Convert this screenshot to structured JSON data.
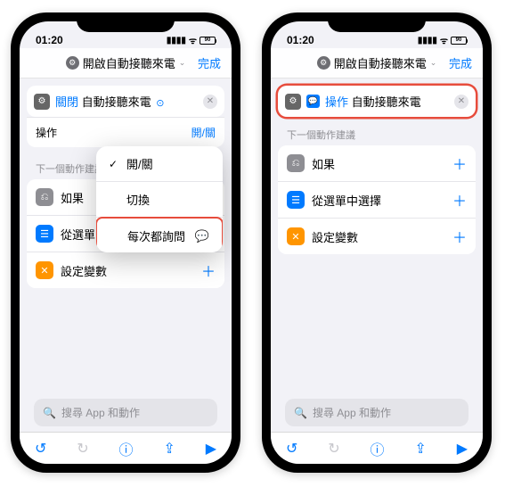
{
  "status": {
    "time": "01:20",
    "battery": "90"
  },
  "nav": {
    "title": "開啟自動接聽來電",
    "done": "完成"
  },
  "left": {
    "action_state": "關閉",
    "action_label": "自動接聽來電",
    "param_label": "操作",
    "param_value": "開/關",
    "section_header": "下一個動作建議",
    "suggestions": {
      "if": "如果",
      "choose": "從選單中選擇",
      "setvar": "設定變數"
    },
    "popup": {
      "opt1": "開/關",
      "opt2": "切換",
      "opt3": "每次都詢問"
    }
  },
  "right": {
    "action_chip": "操作",
    "action_label": "自動接聽來電",
    "section_header": "下一個動作建議",
    "suggestions": {
      "if": "如果",
      "choose": "從選單中選擇",
      "setvar": "設定變數"
    }
  },
  "search": {
    "placeholder": "搜尋 App 和動作"
  }
}
